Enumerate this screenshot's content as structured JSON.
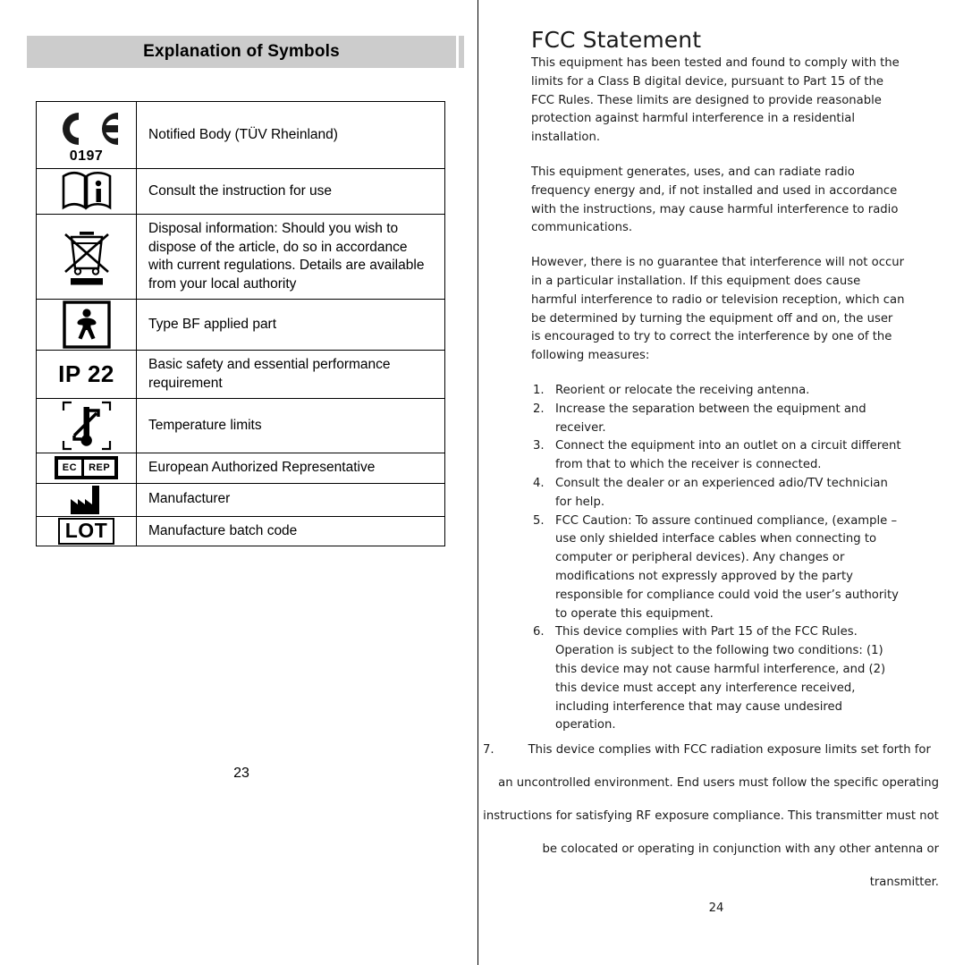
{
  "left_page": {
    "banner_title": "Explanation of Symbols",
    "page_number": "23",
    "table": {
      "rows": [
        {
          "icon": "ce-mark-icon",
          "icon_text": "CE",
          "icon_subtext": "0197",
          "description": "Notified Body (TÜV Rheinland)"
        },
        {
          "icon": "consult-instructions-icon",
          "icon_text": "",
          "icon_subtext": "",
          "description": "Consult the instruction for use"
        },
        {
          "icon": "weee-crossed-bin-icon",
          "icon_text": "",
          "icon_subtext": "",
          "description": "Disposal information: Should you wish to dispose of the article, do so in accordance with current regulations. Details are available from your local authority"
        },
        {
          "icon": "type-bf-applied-part-icon",
          "icon_text": "",
          "icon_subtext": "",
          "description": "Type BF applied part"
        },
        {
          "icon": "ip-rating-icon",
          "icon_text": "IP 22",
          "icon_subtext": "",
          "description": "Basic safety and essential performance requirement"
        },
        {
          "icon": "temperature-limits-icon",
          "icon_text": "",
          "icon_subtext": "",
          "description": "Temperature limits"
        },
        {
          "icon": "ec-rep-icon",
          "icon_text": "EC",
          "icon_subtext": "REP",
          "description": "European Authorized Representative"
        },
        {
          "icon": "manufacturer-factory-icon",
          "icon_text": "",
          "icon_subtext": "",
          "description": "Manufacturer"
        },
        {
          "icon": "lot-batch-code-icon",
          "icon_text": "LOT",
          "icon_subtext": "",
          "description": "Manufacture batch code"
        }
      ]
    }
  },
  "right_page": {
    "heading": "FCC Statement",
    "page_number": "24",
    "paragraphs": [
      "This equipment has been tested and found to comply with the limits for a Class B digital device, pursuant to Part 15 of the FCC Rules. These limits are designed to provide reasonable protection against harmful interference in a residential installation.",
      "This equipment generates, uses, and can radiate radio frequency energy and, if not installed and used in accordance with the instructions, may cause harmful interference to radio communications.",
      "However, there is no guarantee that interference will not occur in a particular installation. If this equipment does cause harmful interference to radio or television reception, which can be determined by turning the equipment off and on, the user is encouraged to try to correct the interference by one of the following measures:"
    ],
    "measures": [
      {
        "number": "1.",
        "text": "Reorient or relocate the receiving antenna."
      },
      {
        "number": "2.",
        "text": "Increase the separation between the equipment and receiver."
      },
      {
        "number": "3.",
        "text": "Connect the equipment into an outlet on a circuit different from that to which the receiver is connected."
      },
      {
        "number": "4.",
        "text": "Consult the dealer or an experienced adio/TV technician for help."
      },
      {
        "number": "5.",
        "text": "FCC Caution: To assure continued compliance, (example – use only shielded interface cables when connecting to computer or peripheral devices). Any changes or modifications not expressly approved by the party responsible for compliance could void the user’s authority to operate this equipment."
      },
      {
        "number": "6.",
        "text": "This device complies with Part 15 of the FCC Rules. Operation is subject to the following two conditions: (1) this device may not cause harmful interference, and (2) this device must accept any interference received, including interference that may cause undesired operation."
      }
    ],
    "item7": {
      "number": "7.",
      "lines": [
        "This device complies with FCC radiation exposure limits set forth for",
        "an uncontrolled environment. End users must follow the specific operating",
        "instructions for satisfying RF exposure compliance. This transmitter must not",
        "be colocated or operating in conjunction with any other antenna or",
        "transmitter."
      ]
    }
  },
  "colors": {
    "banner_background": "#cccccc",
    "text": "#000000",
    "right_text": "#1a1a1a",
    "rule": "#000000"
  }
}
